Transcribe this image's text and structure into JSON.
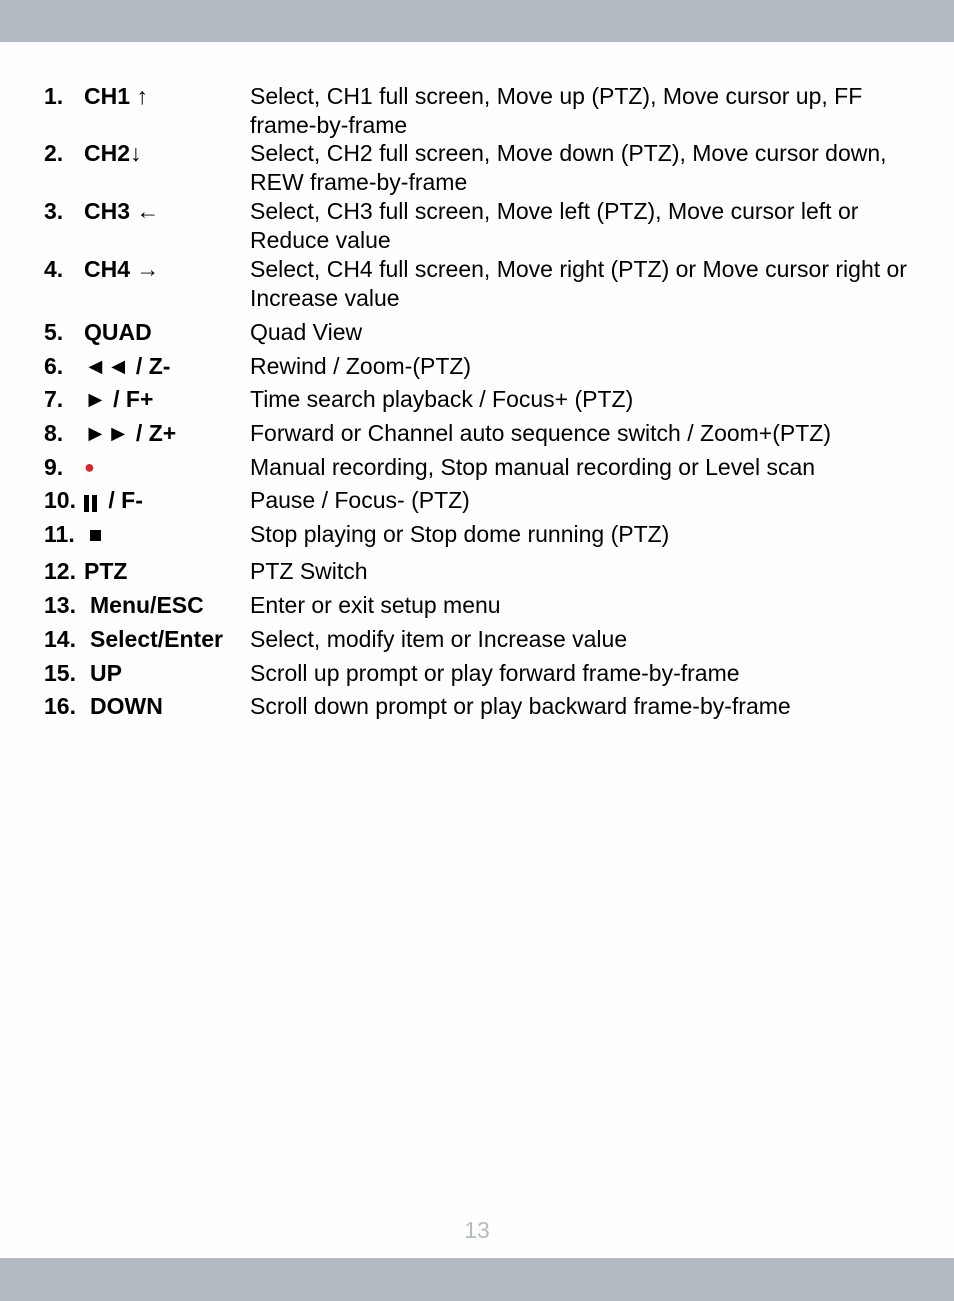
{
  "page": {
    "number": "13"
  },
  "colors": {
    "bar": "#b4bac2",
    "record_dot": "#d9262e",
    "page_number": "#b4bac2"
  },
  "items": [
    {
      "num": "1.",
      "key": "CH1",
      "icon": "arrow-up-icon",
      "glyph": "↑",
      "desc": "Select, CH1 full screen, Move up (PTZ), Move cursor up, FF frame-by-frame"
    },
    {
      "num": "2.",
      "key": "CH2",
      "icon": "arrow-down-icon",
      "glyph": "↓",
      "desc": "Select, CH2 full screen, Move down (PTZ), Move cursor down, REW frame-by-frame"
    },
    {
      "num": "3.",
      "key": "CH3",
      "icon": "arrow-left-icon",
      "glyph": "←",
      "desc": "Select, CH3 full screen, Move left (PTZ), Move cursor left or Reduce value"
    },
    {
      "num": "4.",
      "key": "CH4",
      "icon": "arrow-right-icon",
      "glyph": "→",
      "desc": "Select, CH4 full screen, Move right (PTZ) or Move cursor right or Increase value"
    },
    {
      "num": "5.",
      "key": "QUAD",
      "desc": "Quad View"
    },
    {
      "num": "6.",
      "key": "◄◄ / Z-",
      "icon": "rewind-icon",
      "desc": "Rewind / Zoom-(PTZ)"
    },
    {
      "num": "7.",
      "key": "► / F+",
      "icon": "play-icon",
      "desc": "Time search playback / Focus+ (PTZ)"
    },
    {
      "num": "8.",
      "key": "►► / Z+",
      "icon": "fast-forward-icon",
      "desc": "Forward or Channel auto sequence switch / Zoom+(PTZ)"
    },
    {
      "num": "9.",
      "key": "●",
      "icon": "record-icon",
      "desc": "Manual recording, Stop manual recording or Level scan"
    },
    {
      "num": "10.",
      "key": "/ F-",
      "icon": "pause-icon",
      "desc": "Pause / Focus- (PTZ)"
    },
    {
      "num": "11.",
      "key": "",
      "icon": "stop-icon",
      "desc": "Stop playing or Stop dome running (PTZ)"
    },
    {
      "num": "12.",
      "key": "PTZ",
      "desc": "PTZ Switch"
    },
    {
      "num": "13.",
      "key": "Menu/ESC",
      "desc": "Enter or exit setup menu"
    },
    {
      "num": "14.",
      "key": "Select/Enter",
      "desc": "Select, modify item or Increase value"
    },
    {
      "num": "15.",
      "key": "UP",
      "desc": "Scroll up prompt or play forward frame-by-frame"
    },
    {
      "num": "16.",
      "key": "DOWN",
      "desc": "Scroll down prompt or play backward frame-by-frame"
    }
  ]
}
